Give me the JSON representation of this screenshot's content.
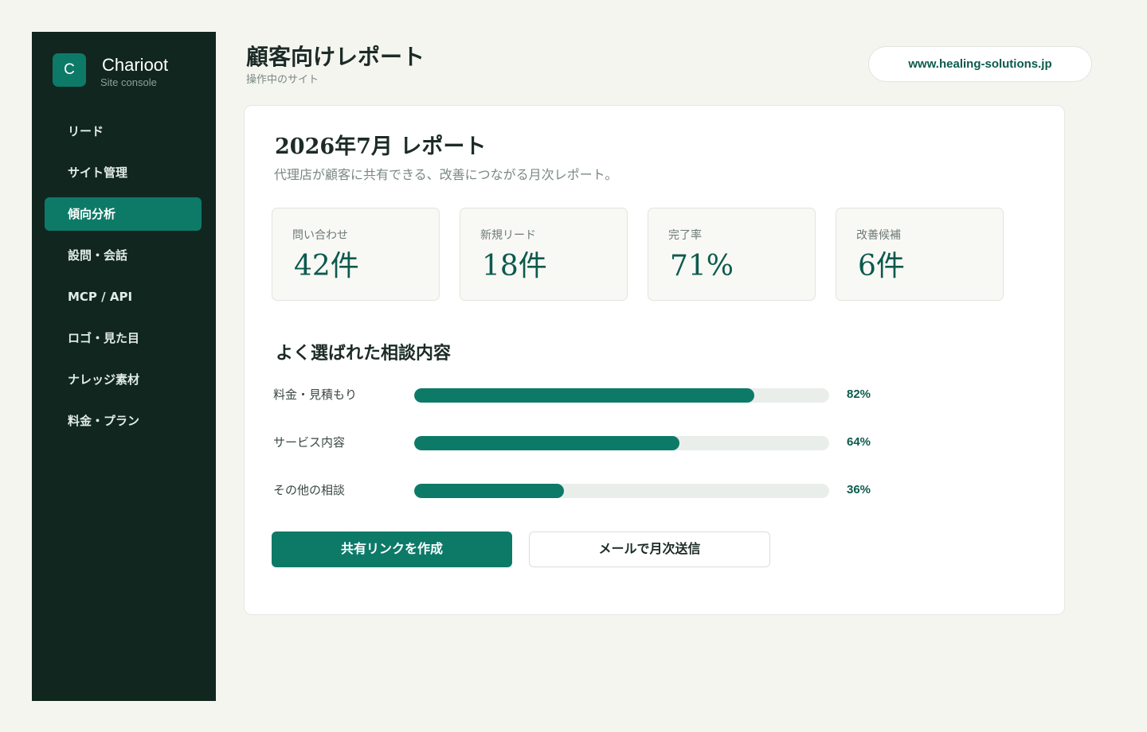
{
  "brand": {
    "logo_letter": "C",
    "name": "Charioot",
    "subtitle": "Site console"
  },
  "sidebar": {
    "items": [
      {
        "label": "リード",
        "active": false
      },
      {
        "label": "サイト管理",
        "active": false
      },
      {
        "label": "傾向分析",
        "active": true
      },
      {
        "label": "設問・会話",
        "active": false
      },
      {
        "label": "MCP / API",
        "active": false
      },
      {
        "label": "ロゴ・見た目",
        "active": false
      },
      {
        "label": "ナレッジ素材",
        "active": false
      },
      {
        "label": "料金・プラン",
        "active": false
      }
    ]
  },
  "header": {
    "title": "顧客向けレポート",
    "subtitle": "操作中のサイト",
    "site": "www.healing-solutions.jp"
  },
  "report": {
    "title": "2026年7月 レポート",
    "description": "代理店が顧客に共有できる、改善につながる月次レポート。",
    "stats": [
      {
        "label": "問い合わせ",
        "value": "42件"
      },
      {
        "label": "新規リード",
        "value": "18件"
      },
      {
        "label": "完了率",
        "value": "71%"
      },
      {
        "label": "改善候補",
        "value": "6件"
      }
    ],
    "section_title": "よく選ばれた相談内容",
    "topics": [
      {
        "label": "料金・見積もり",
        "percent_text": "82%",
        "percent": 82
      },
      {
        "label": "サービス内容",
        "percent_text": "64%",
        "percent": 64
      },
      {
        "label": "その他の相談",
        "percent_text": "36%",
        "percent": 36
      }
    ],
    "actions": {
      "share_label": "共有リンクを作成",
      "mail_label": "メールで月次送信"
    }
  },
  "colors": {
    "accent": "#0d7a68",
    "sidebar_bg": "#10261f",
    "page_bg": "#f5f5f0",
    "track": "#eaeeeb"
  }
}
